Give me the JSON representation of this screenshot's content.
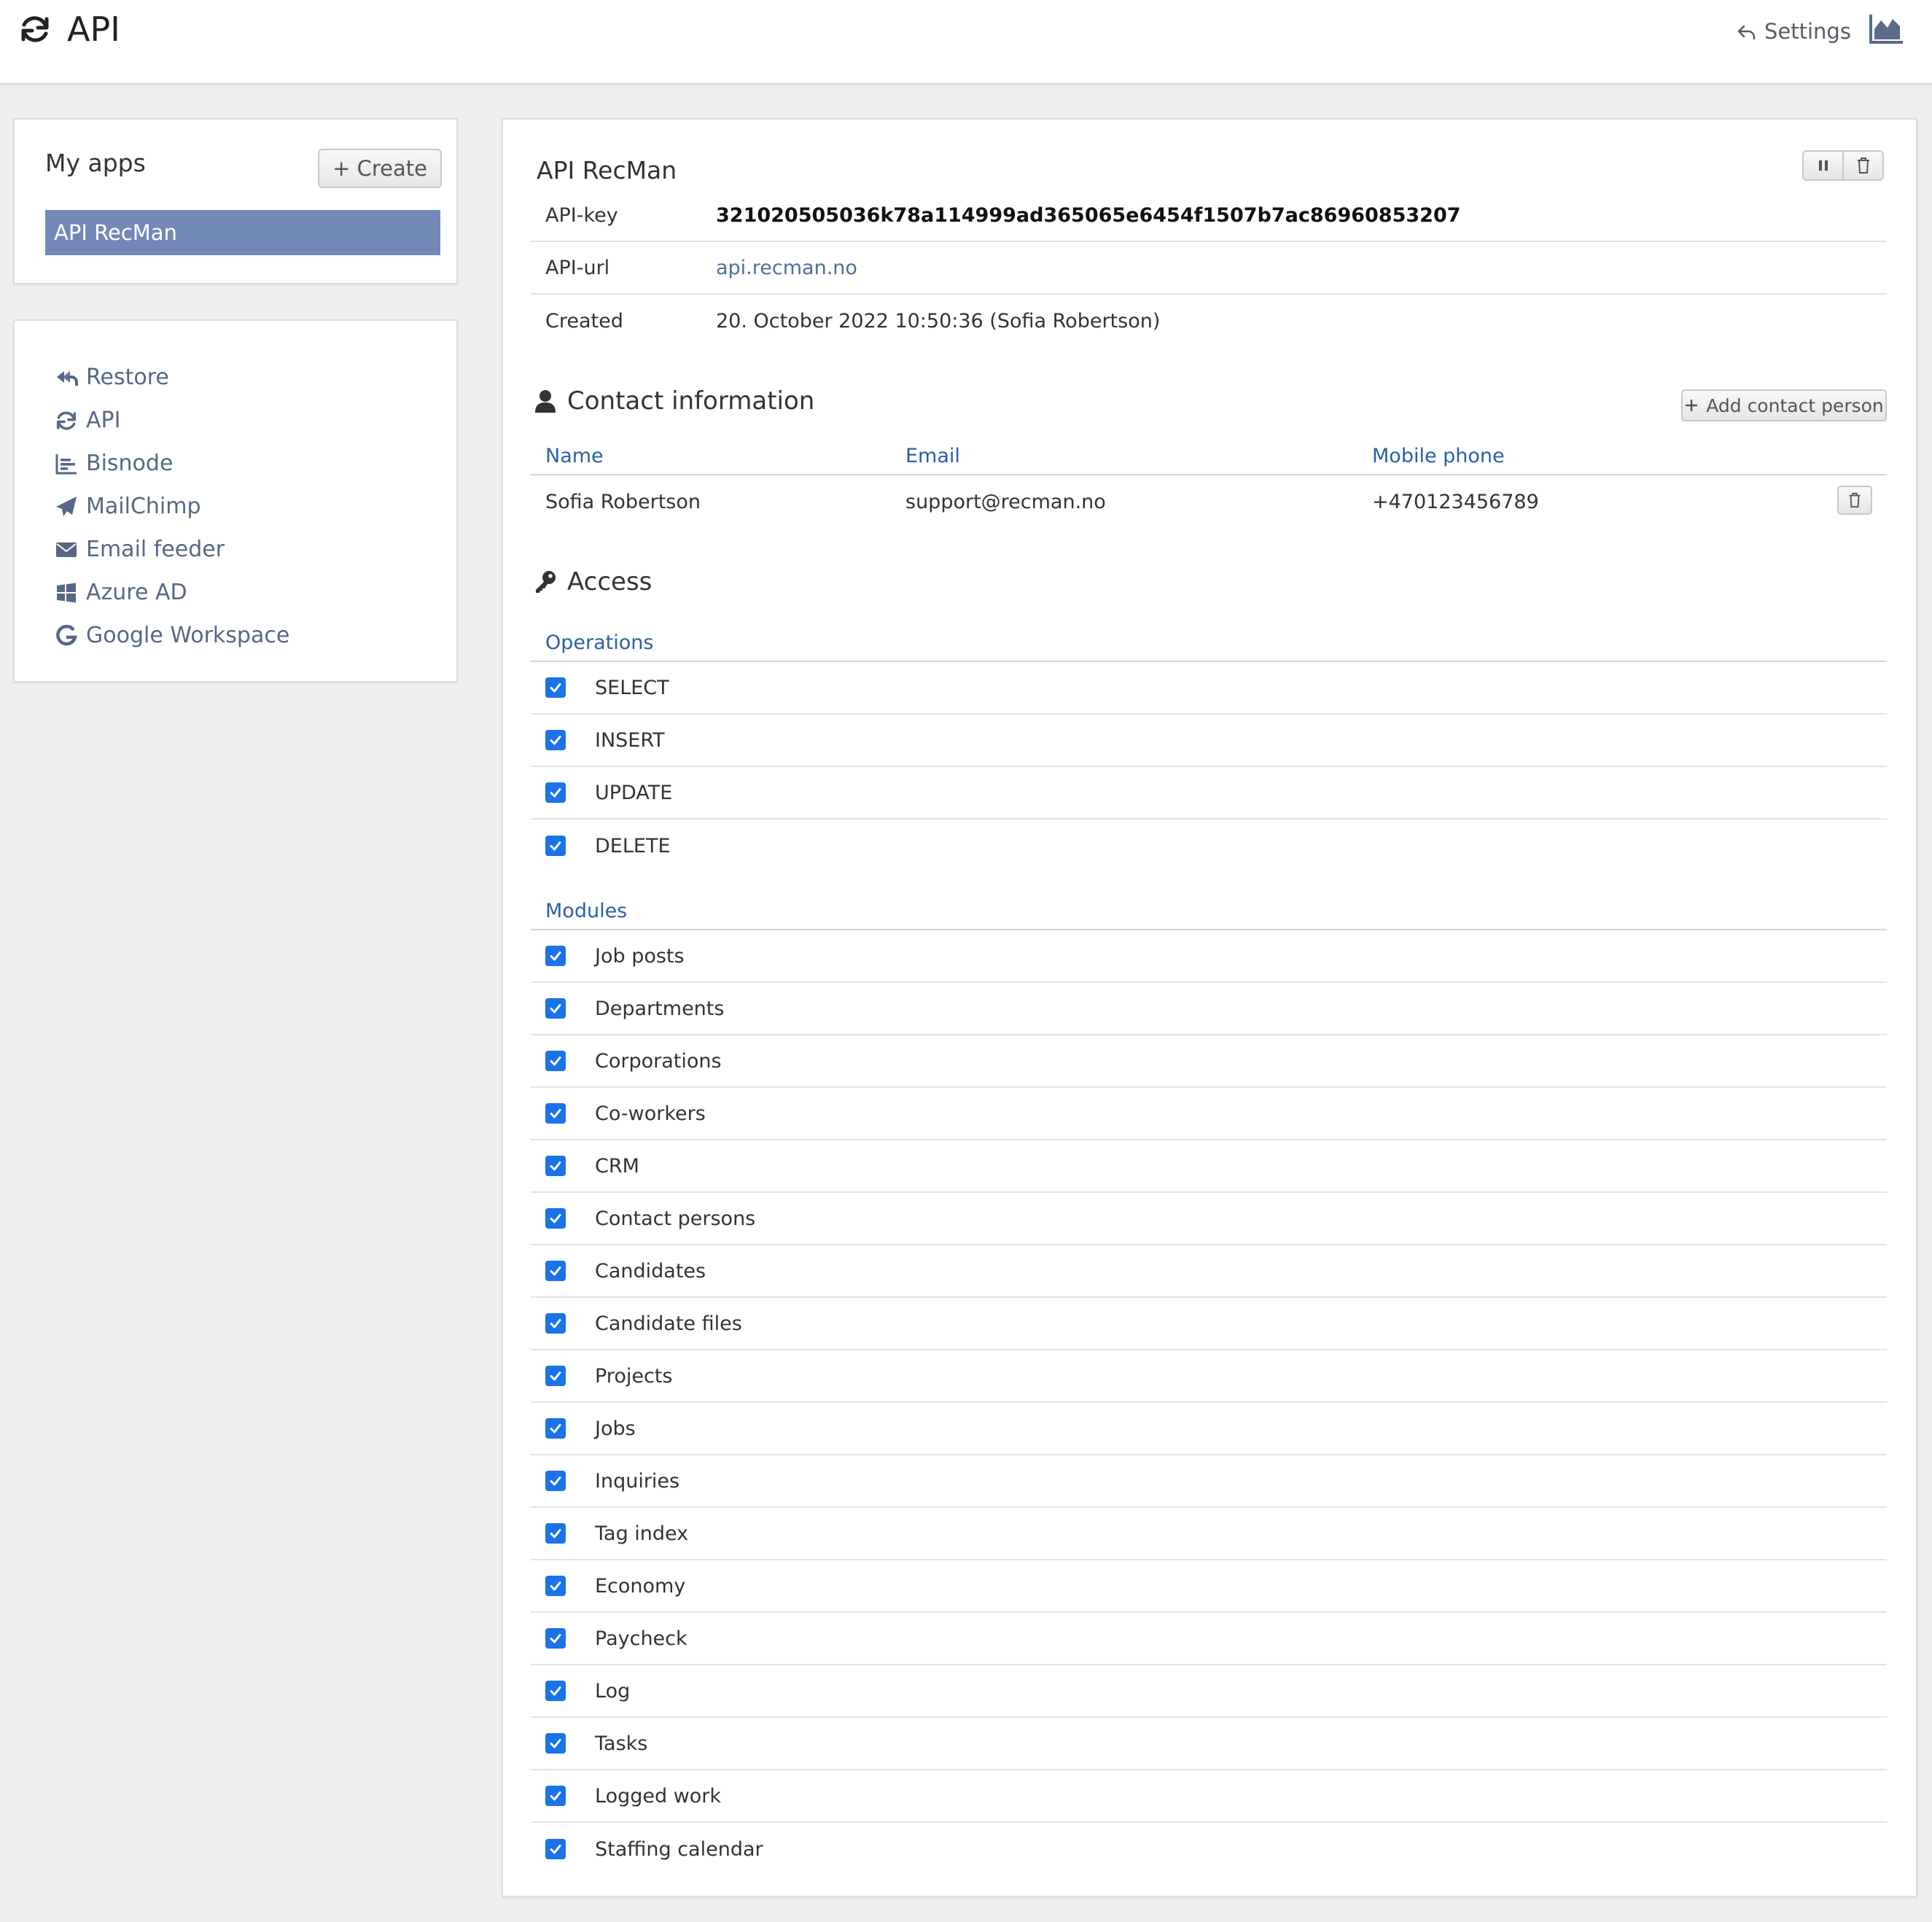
{
  "header": {
    "title": "API",
    "settings_label": "Settings"
  },
  "apps": {
    "title": "My apps",
    "create_label": "+ Create",
    "items": [
      "API RecMan"
    ]
  },
  "nav": {
    "items": [
      {
        "label": "Restore",
        "icon": "restore-icon"
      },
      {
        "label": "API",
        "icon": "sync-icon"
      },
      {
        "label": "Bisnode",
        "icon": "bar-chart-icon"
      },
      {
        "label": "MailChimp",
        "icon": "paper-plane-icon"
      },
      {
        "label": "Email feeder",
        "icon": "envelope-icon"
      },
      {
        "label": "Azure AD",
        "icon": "windows-icon"
      },
      {
        "label": "Google Workspace",
        "icon": "google-icon"
      }
    ]
  },
  "app_detail": {
    "title": "API RecMan",
    "fields": [
      {
        "key": "API-key",
        "value": "321020505036k78a114999ad365065e6454f1507b7ac86960853207"
      },
      {
        "key": "API-url",
        "value": "api.recman.no"
      },
      {
        "key": "Created",
        "value": "20. October 2022 10:50:36 (Sofia Robertson)"
      }
    ]
  },
  "contact": {
    "title": "Contact information",
    "add_label": "Add contact person",
    "columns": [
      "Name",
      "Email",
      "Mobile phone"
    ],
    "rows": [
      {
        "name": "Sofia Robertson",
        "email": "support@recman.no",
        "phone": "+470123456789"
      }
    ]
  },
  "access": {
    "title": "Access",
    "operations_label": "Operations",
    "operations": [
      "SELECT",
      "INSERT",
      "UPDATE",
      "DELETE"
    ],
    "modules_label": "Modules",
    "modules": [
      "Job posts",
      "Departments",
      "Corporations",
      "Co-workers",
      "CRM",
      "Contact persons",
      "Candidates",
      "Candidate files",
      "Projects",
      "Jobs",
      "Inquiries",
      "Tag index",
      "Economy",
      "Paycheck",
      "Log",
      "Tasks",
      "Logged work",
      "Staffing calendar"
    ]
  },
  "colors": {
    "accent": "#7289b7",
    "link": "#2b5fa6",
    "checkbox": "#1a73e8"
  }
}
